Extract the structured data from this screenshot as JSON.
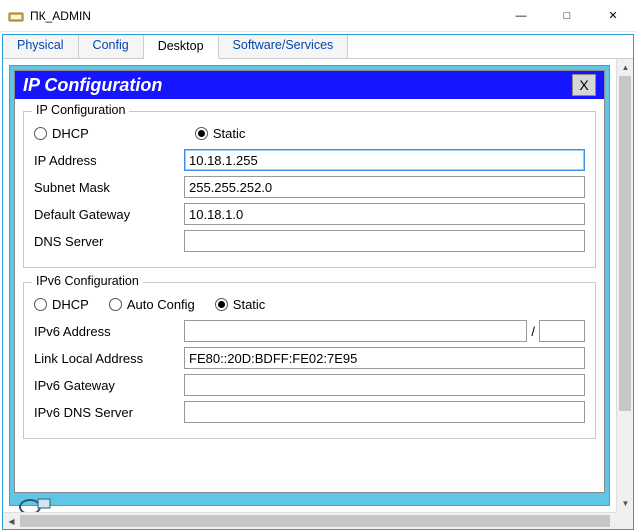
{
  "window": {
    "title": "ПК_ADMIN",
    "controls": {
      "minimize": "—",
      "maximize": "□",
      "close": "✕"
    }
  },
  "tabs": [
    "Physical",
    "Config",
    "Desktop",
    "Software/Services"
  ],
  "selected_tab_index": 2,
  "dialog": {
    "title": "IP Configuration",
    "close_label": "X"
  },
  "ipv4": {
    "legend": "IP Configuration",
    "mode_dhcp_label": "DHCP",
    "mode_static_label": "Static",
    "selected_mode": "static",
    "fields": {
      "ip_label": "IP Address",
      "ip_value": "10.18.1.255",
      "mask_label": "Subnet Mask",
      "mask_value": "255.255.252.0",
      "gw_label": "Default Gateway",
      "gw_value": "10.18.1.0",
      "dns_label": "DNS Server",
      "dns_value": ""
    }
  },
  "ipv6": {
    "legend": "IPv6 Configuration",
    "mode_dhcp_label": "DHCP",
    "mode_auto_label": "Auto Config",
    "mode_static_label": "Static",
    "selected_mode": "static",
    "fields": {
      "addr_label": "IPv6 Address",
      "addr_value": "",
      "prefix_value": "",
      "ll_label": "Link Local Address",
      "ll_value": "FE80::20D:BDFF:FE02:7E95",
      "gw_label": "IPv6 Gateway",
      "gw_value": "",
      "dns_label": "IPv6 DNS Server",
      "dns_value": ""
    }
  }
}
